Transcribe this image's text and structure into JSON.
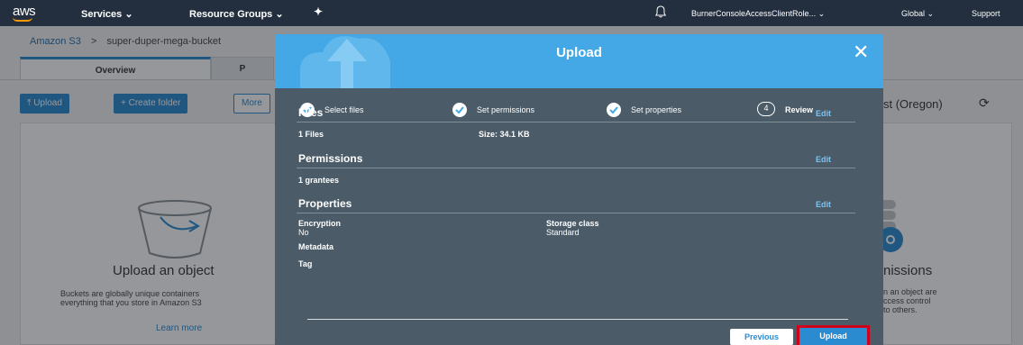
{
  "topnav": {
    "logo": "aws",
    "services": "Services",
    "resource_groups": "Resource Groups",
    "caret": "⌄",
    "pin_icon": "pin-icon",
    "bell_icon": "bell-icon",
    "account": "BurnerConsoleAccessClientRole...",
    "region": "Global",
    "support": "Support"
  },
  "breadcrumb": {
    "root": "Amazon S3",
    "separator": ">",
    "bucket": "super-duper-mega-bucket"
  },
  "tabs": [
    {
      "label": "Overview"
    },
    {
      "label": "P"
    }
  ],
  "toolbar": {
    "upload": "Upload",
    "create_folder": "Create folder",
    "more": "More"
  },
  "region_label": "st (Oregon)",
  "cards": {
    "upload_title": "Upload an object",
    "upload_desc_1": "Buckets are globally unique containers",
    "upload_desc_2": "everything that you store in Amazon S3",
    "learn_more": "Learn more",
    "perm_title": "nissions",
    "perm_desc_1": "n an object are",
    "perm_desc_2": "ccess control",
    "perm_desc_3": "to others."
  },
  "modal": {
    "title": "Upload",
    "close": "✕",
    "steps": [
      {
        "label": "Select files",
        "state": "done"
      },
      {
        "label": "Set permissions",
        "state": "done"
      },
      {
        "label": "Set properties",
        "state": "done"
      },
      {
        "label": "Review",
        "number": "4",
        "state": "current"
      }
    ],
    "files": {
      "heading": "Files",
      "edit": "Edit",
      "count": "1 Files",
      "size": "Size: 34.1 KB"
    },
    "permissions": {
      "heading": "Permissions",
      "edit": "Edit",
      "grantees": "1 grantees"
    },
    "properties": {
      "heading": "Properties",
      "edit": "Edit",
      "encryption_label": "Encryption",
      "encryption_value": "No",
      "storage_label": "Storage class",
      "storage_value": "Standard",
      "metadata_label": "Metadata",
      "tag_label": "Tag"
    },
    "previous": "Previous",
    "upload": "Upload"
  },
  "colors": {
    "nav": "#232f3e",
    "accent": "#2b8bd1",
    "modal_header": "#44a8e6",
    "modal_body": "#4b5c68",
    "highlight": "#d0021b"
  }
}
